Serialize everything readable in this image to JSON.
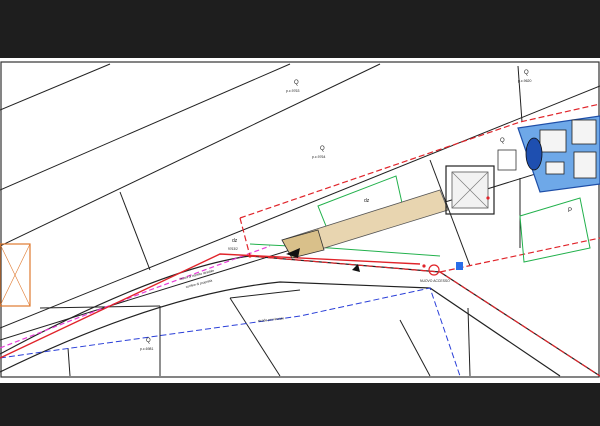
{
  "drawing": {
    "parcel_labels": {
      "q_top_center": "Q",
      "q_top_right": "Q",
      "q_middle": "Q",
      "q_bottom_left": "Q",
      "q_right_unit": "Q",
      "p_right": "P",
      "dz_plot": "dz",
      "dz_left": "dz"
    },
    "parcel_numbers": {
      "top_center": "p.c.9763",
      "top_right": "p.c.9620",
      "middle": "p.c.9764",
      "bottom_left": "p.c.6981",
      "left_small": "9763/2"
    },
    "annotations": {
      "fascia": "fascia di rispetto stradale",
      "boundary": "confine di proprietà",
      "new_access": "NUOVO ACCESSO",
      "road_name": "strada provinciale"
    },
    "colors": {
      "boundary_red": "#e0242a",
      "magenta_line": "#e83ad8",
      "blue_line": "#2a3fd8",
      "green_outline": "#22b14c",
      "building_fill": "#e8d5b0",
      "house_blue": "#6ea8e8",
      "orange_outline": "#e07a30"
    }
  }
}
